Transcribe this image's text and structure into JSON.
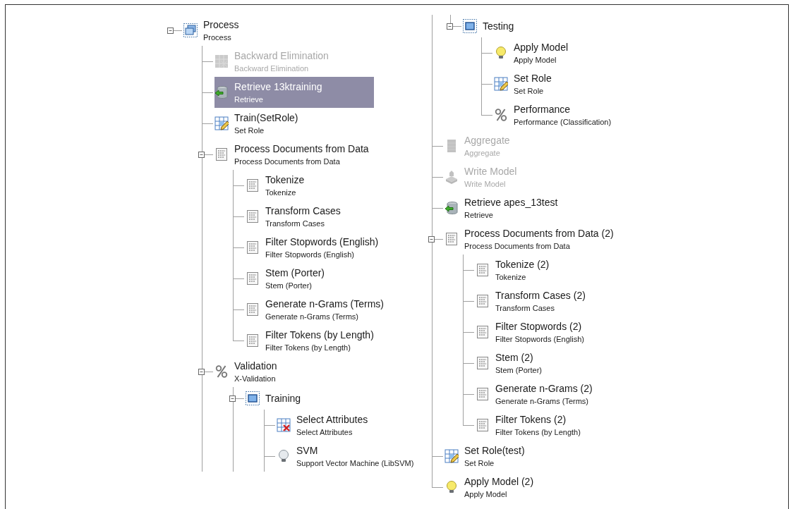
{
  "columns": [
    {
      "nodes": [
        {
          "kind": "process",
          "name": "Process",
          "operator": "Process",
          "expanded": true,
          "continued": true,
          "selected": false,
          "disabled": false,
          "children": [
            {
              "kind": "grid",
              "name": "Backward Elimination",
              "operator": "Backward Elimination",
              "selected": false,
              "disabled": true
            },
            {
              "kind": "retrieve",
              "name": "Retrieve 13ktraining",
              "operator": "Retrieve",
              "selected": true,
              "disabled": false
            },
            {
              "kind": "setrole",
              "name": "Train(SetRole)",
              "operator": "Set Role",
              "selected": false,
              "disabled": false
            },
            {
              "kind": "doc",
              "name": "Process Documents from Data",
              "operator": "Process Documents from Data",
              "expanded": true,
              "selected": false,
              "disabled": false,
              "children": [
                {
                  "kind": "doc",
                  "name": "Tokenize",
                  "operator": "Tokenize",
                  "selected": false,
                  "disabled": false
                },
                {
                  "kind": "doc",
                  "name": "Transform Cases",
                  "operator": "Transform Cases",
                  "selected": false,
                  "disabled": false
                },
                {
                  "kind": "doc",
                  "name": "Filter Stopwords (English)",
                  "operator": "Filter Stopwords (English)",
                  "selected": false,
                  "disabled": false
                },
                {
                  "kind": "doc",
                  "name": "Stem (Porter)",
                  "operator": "Stem (Porter)",
                  "selected": false,
                  "disabled": false
                },
                {
                  "kind": "doc",
                  "name": "Generate n-Grams (Terms)",
                  "operator": "Generate n-Grams (Terms)",
                  "selected": false,
                  "disabled": false
                },
                {
                  "kind": "doc",
                  "name": "Filter Tokens (by Length)",
                  "operator": "Filter Tokens (by Length)",
                  "selected": false,
                  "disabled": false
                }
              ]
            },
            {
              "kind": "percent",
              "name": "Validation",
              "operator": "X-Validation",
              "expanded": true,
              "continued": true,
              "selected": false,
              "disabled": false,
              "children": [
                {
                  "kind": "subprocess",
                  "name": "Training",
                  "expanded": true,
                  "continued": true,
                  "selected": false,
                  "disabled": false,
                  "children": [
                    {
                      "kind": "select",
                      "name": "Select Attributes",
                      "operator": "Select Attributes",
                      "selected": false,
                      "disabled": false
                    },
                    {
                      "kind": "learner",
                      "name": "SVM",
                      "operator": "Support Vector Machine (LibSVM)",
                      "selected": false,
                      "disabled": false
                    }
                  ]
                }
              ]
            }
          ]
        }
      ]
    },
    {
      "nodes": [
        {
          "kind": "continuation",
          "children": [
            {
              "kind": "continuation",
              "children": [
                {
                  "kind": "subprocess",
                  "name": "Testing",
                  "expanded": true,
                  "selected": false,
                  "disabled": false,
                  "children": [
                    {
                      "kind": "apply",
                      "name": "Apply Model",
                      "operator": "Apply Model",
                      "selected": false,
                      "disabled": false
                    },
                    {
                      "kind": "setrole",
                      "name": "Set Role",
                      "operator": "Set Role",
                      "selected": false,
                      "disabled": false
                    },
                    {
                      "kind": "percent",
                      "name": "Performance",
                      "operator": "Performance (Classification)",
                      "selected": false,
                      "disabled": false
                    }
                  ]
                }
              ]
            },
            {
              "kind": "aggregate",
              "name": "Aggregate",
              "operator": "Aggregate",
              "selected": false,
              "disabled": true
            },
            {
              "kind": "write",
              "name": "Write Model",
              "operator": "Write Model",
              "selected": false,
              "disabled": true
            },
            {
              "kind": "retrieve",
              "name": "Retrieve apes_13test",
              "operator": "Retrieve",
              "selected": false,
              "disabled": false
            },
            {
              "kind": "doc",
              "name": "Process Documents from Data (2)",
              "operator": "Process Documents from Data",
              "expanded": true,
              "selected": false,
              "disabled": false,
              "children": [
                {
                  "kind": "doc",
                  "name": "Tokenize (2)",
                  "operator": "Tokenize",
                  "selected": false,
                  "disabled": false
                },
                {
                  "kind": "doc",
                  "name": "Transform Cases (2)",
                  "operator": "Transform Cases",
                  "selected": false,
                  "disabled": false
                },
                {
                  "kind": "doc",
                  "name": "Filter Stopwords (2)",
                  "operator": "Filter Stopwords (English)",
                  "selected": false,
                  "disabled": false
                },
                {
                  "kind": "doc",
                  "name": "Stem (2)",
                  "operator": "Stem (Porter)",
                  "selected": false,
                  "disabled": false
                },
                {
                  "kind": "doc",
                  "name": "Generate n-Grams (2)",
                  "operator": "Generate n-Grams (Terms)",
                  "selected": false,
                  "disabled": false
                },
                {
                  "kind": "doc",
                  "name": "Filter Tokens (2)",
                  "operator": "Filter Tokens (by Length)",
                  "selected": false,
                  "disabled": false
                }
              ]
            },
            {
              "kind": "setrole",
              "name": "Set Role(test)",
              "operator": "Set Role",
              "selected": false,
              "disabled": false
            },
            {
              "kind": "apply",
              "name": "Apply Model (2)",
              "operator": "Apply Model",
              "selected": false,
              "disabled": false
            }
          ]
        }
      ]
    }
  ]
}
